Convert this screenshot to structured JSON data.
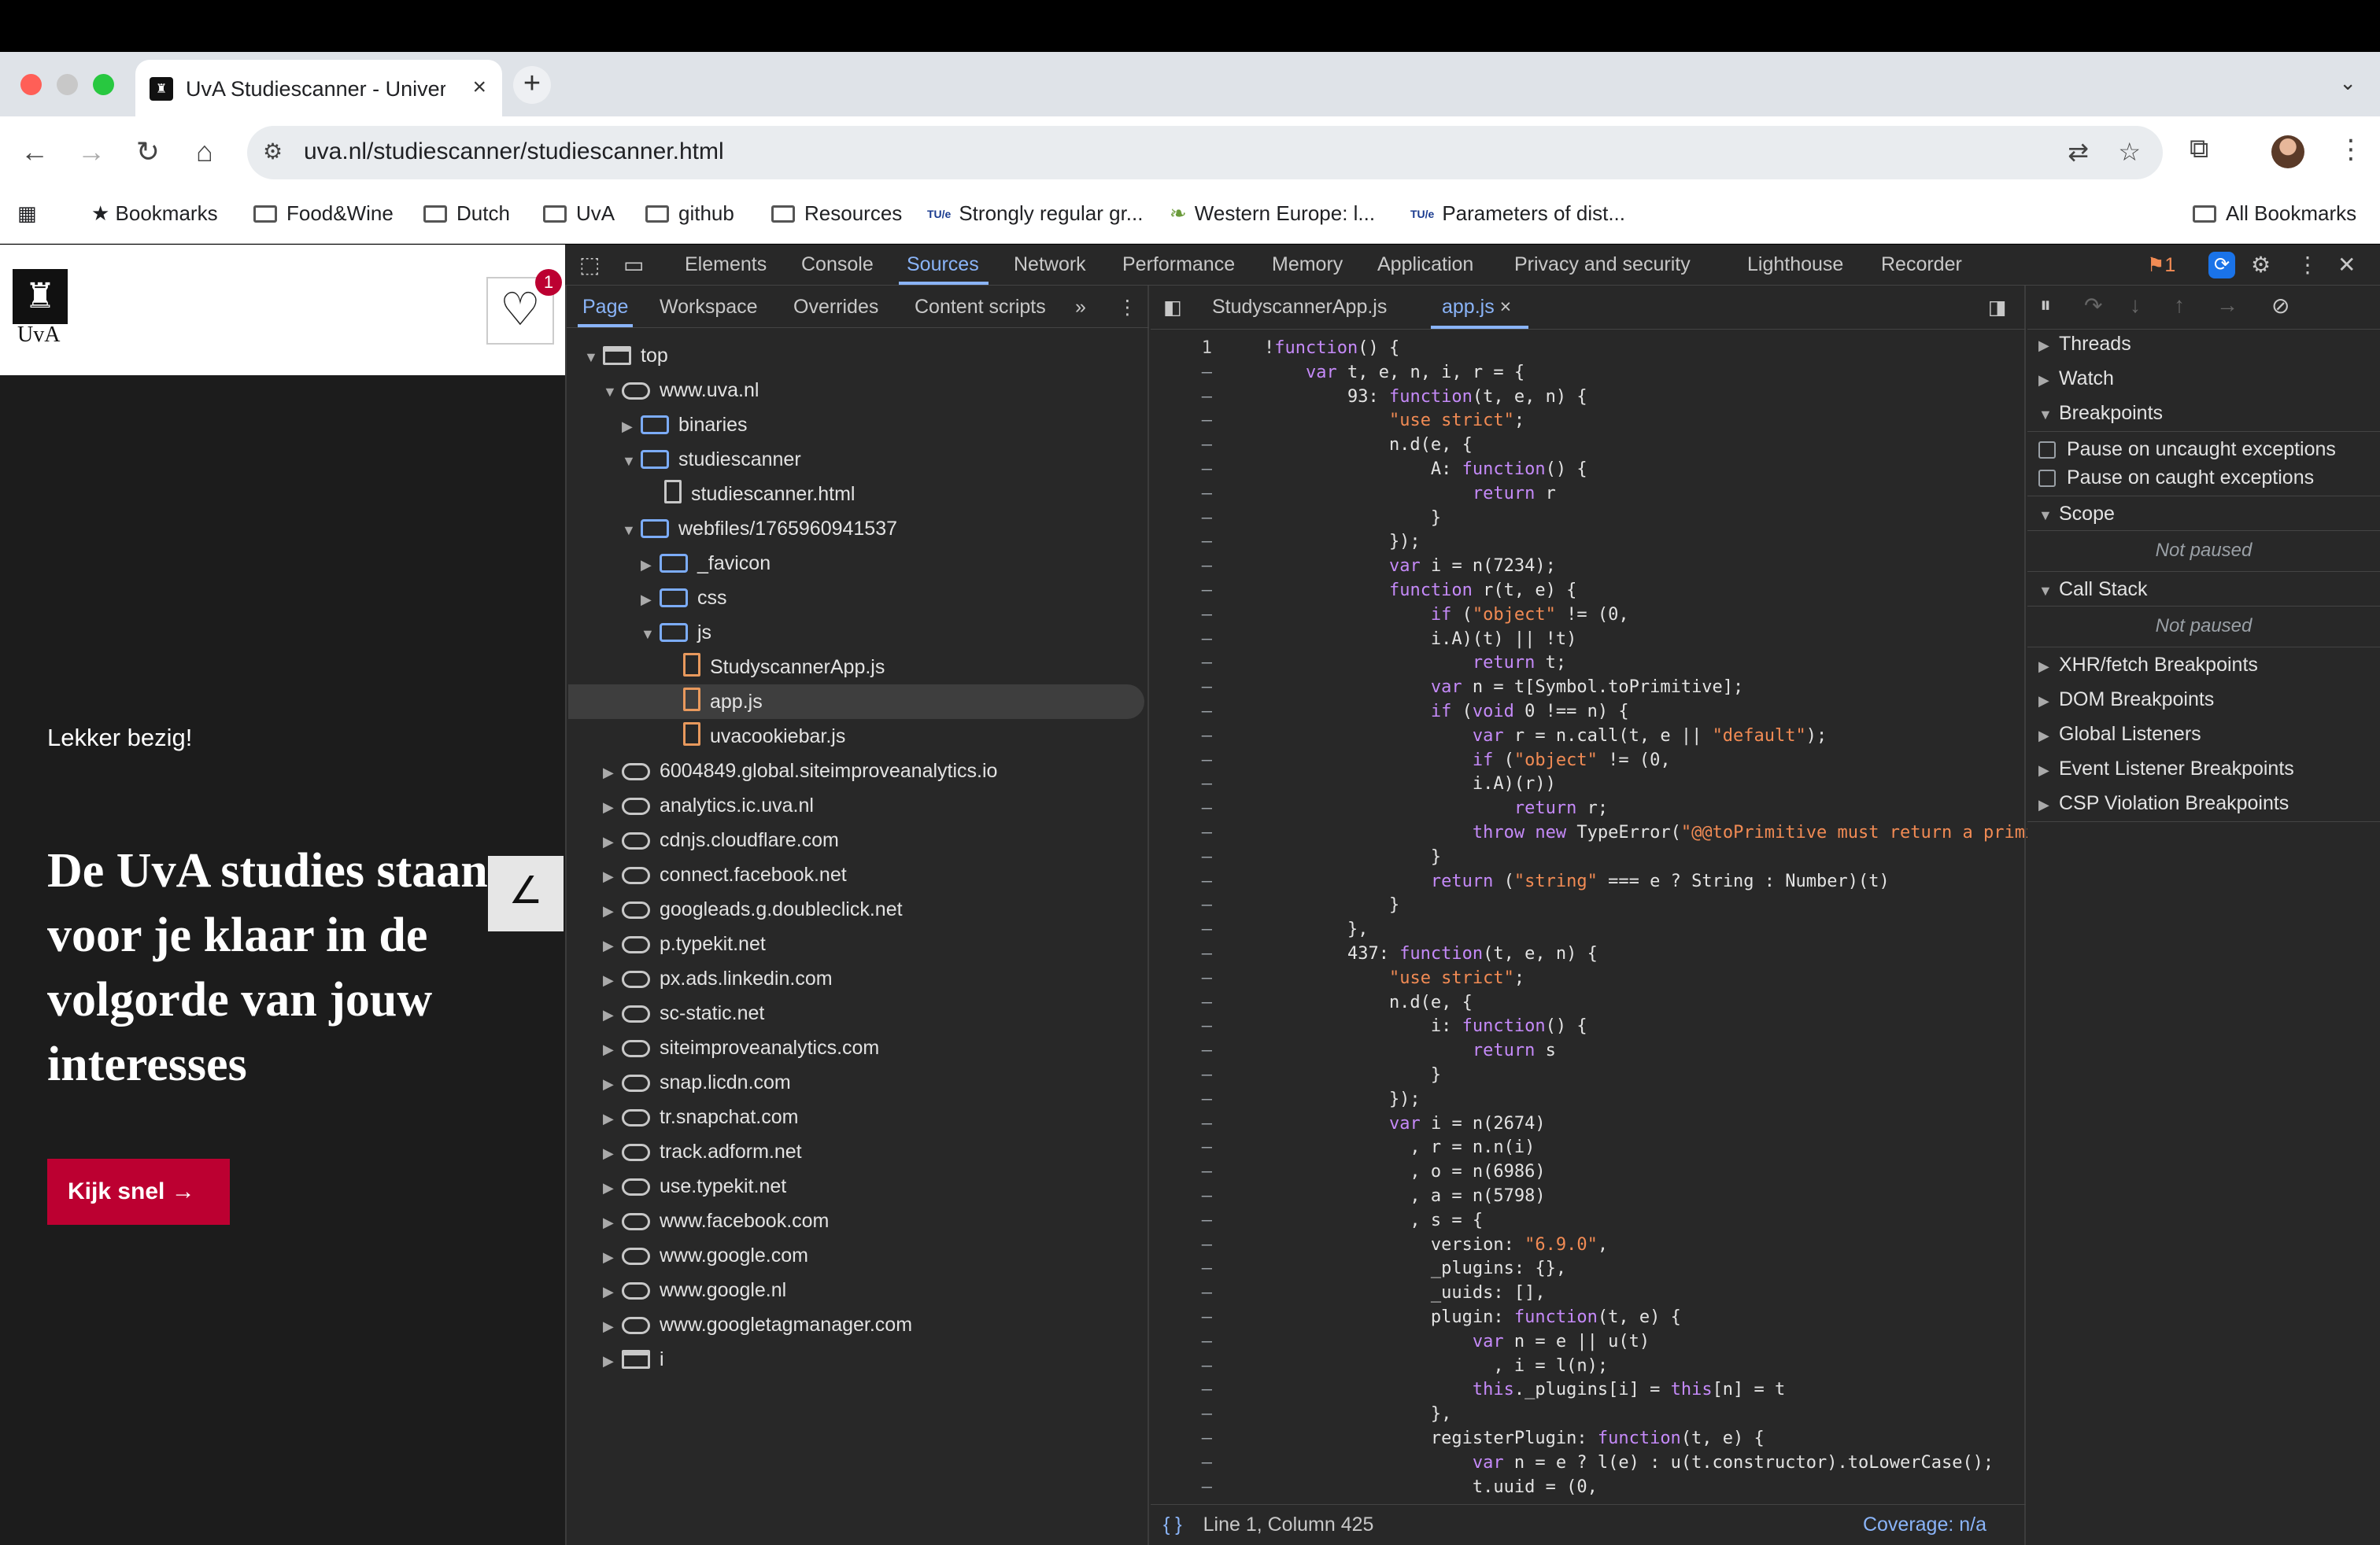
{
  "browser": {
    "tab_title": "UvA Studiescanner - Universi",
    "tab_close": "×",
    "new_tab": "+",
    "url": "uva.nl/studiescanner/studiescanner.html"
  },
  "bookmarks": {
    "bookmarks_label": "Bookmarks",
    "items": [
      "Food&Wine",
      "Dutch",
      "UvA",
      "github",
      "Resources",
      "Strongly regular gr...",
      "Western Europe: l...",
      "Parameters of dist..."
    ],
    "all_bookmarks": "All Bookmarks"
  },
  "page": {
    "logo_text": "UvA",
    "badge_count": "1",
    "eyebrow": "Lekker bezig!",
    "headline": "De UvA studies staan voor je klaar in de volgorde van jouw interesses",
    "cta_label": "Kijk snel  →"
  },
  "devtools": {
    "tabs": [
      "Elements",
      "Console",
      "Sources",
      "Network",
      "Performance",
      "Memory",
      "Application",
      "Privacy and security",
      "Lighthouse",
      "Recorder"
    ],
    "issues_count": "1",
    "nav_tabs": [
      "Page",
      "Workspace",
      "Overrides",
      "Content scripts"
    ],
    "tree": [
      "top",
      "www.uva.nl",
      "binaries",
      "studiescanner",
      "studiescanner.html",
      "webfiles/1765960941537",
      "_favicon",
      "css",
      "js",
      "StudyscannerApp.js",
      "app.js",
      "uvacookiebar.js",
      "6004849.global.siteimproveanalytics.io",
      "analytics.ic.uva.nl",
      "cdnjs.cloudflare.com",
      "connect.facebook.net",
      "googleads.g.doubleclick.net",
      "p.typekit.net",
      "px.ads.linkedin.com",
      "sc-static.net",
      "siteimproveanalytics.com",
      "snap.licdn.com",
      "tr.snapchat.com",
      "track.adform.net",
      "use.typekit.net",
      "www.facebook.com",
      "www.google.com",
      "www.google.nl",
      "www.googletagmanager.com",
      "i"
    ],
    "editor_tabs": [
      "StudyscannerApp.js",
      "app.js"
    ],
    "editor_tab_close": "×",
    "status_position": "Line 1, Column 425",
    "status_coverage": "Coverage: n/a",
    "first_line_number": "1",
    "other_line_marker": "–",
    "code_lines": [
      "!function() {",
      "    var t, e, n, i, r = {",
      "        93: function(t, e, n) {",
      "            \"use strict\";",
      "            n.d(e, {",
      "                A: function() {",
      "                    return r",
      "                }",
      "            });",
      "            var i = n(7234);",
      "            function r(t, e) {",
      "                if (\"object\" != (0,",
      "                i.A)(t) || !t)",
      "                    return t;",
      "                var n = t[Symbol.toPrimitive];",
      "                if (void 0 !== n) {",
      "                    var r = n.call(t, e || \"default\");",
      "                    if (\"object\" != (0,",
      "                    i.A)(r))",
      "                        return r;",
      "                    throw new TypeError(\"@@toPrimitive must return a primi",
      "                }",
      "                return (\"string\" === e ? String : Number)(t)",
      "            }",
      "        },",
      "        437: function(t, e, n) {",
      "            \"use strict\";",
      "            n.d(e, {",
      "                i: function() {",
      "                    return s",
      "                }",
      "            });",
      "            var i = n(2674)",
      "              , r = n.n(i)",
      "              , o = n(6986)",
      "              , a = n(5798)",
      "              , s = {",
      "                version: \"6.9.0\",",
      "                _plugins: {},",
      "                _uuids: [],",
      "                plugin: function(t, e) {",
      "                    var n = e || u(t)",
      "                      , i = l(n);",
      "                    this._plugins[i] = this[n] = t",
      "                },",
      "                registerPlugin: function(t, e) {",
      "                    var n = e ? l(e) : u(t.constructor).toLowerCase();",
      "                    t.uuid = (0,"
    ],
    "debugger": {
      "threads": "Threads",
      "watch": "Watch",
      "breakpoints": "Breakpoints",
      "pause_uncaught": "Pause on uncaught exceptions",
      "pause_caught": "Pause on caught exceptions",
      "scope": "Scope",
      "not_paused": "Not paused",
      "call_stack": "Call Stack",
      "xhr": "XHR/fetch Breakpoints",
      "dom": "DOM Breakpoints",
      "global": "Global Listeners",
      "event": "Event Listener Breakpoints",
      "csp": "CSP Violation Breakpoints"
    }
  },
  "colors": {
    "accent": "#8ab4f8",
    "uva_red": "#bc0031",
    "devtools_bg": "#282828"
  }
}
